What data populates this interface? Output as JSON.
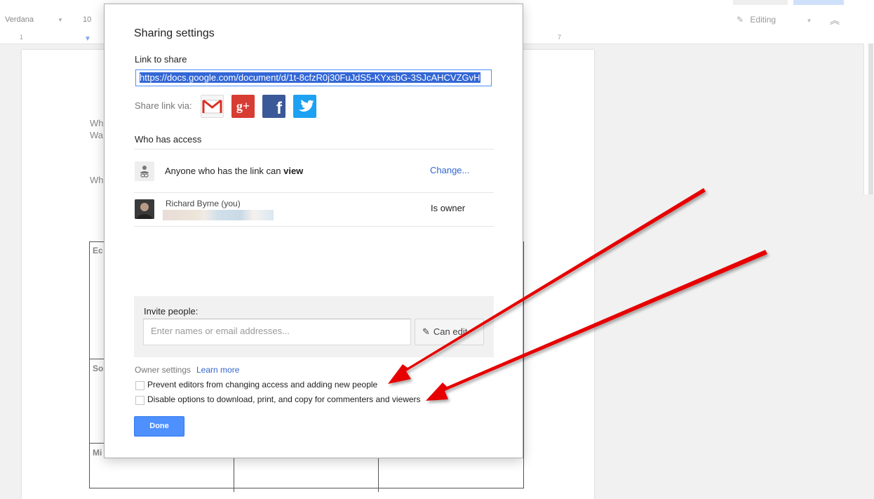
{
  "toolbar": {
    "font_name": "Verdana",
    "font_size": "10",
    "mode_label": "Editing"
  },
  "ruler": {
    "marks": [
      "1",
      "7"
    ]
  },
  "document": {
    "text_line_1": "Wh",
    "text_line_2": "Wa",
    "text_line_3": "Wh",
    "table_cells": [
      "Ec",
      "So",
      "Mi"
    ]
  },
  "dialog": {
    "title": "Sharing settings",
    "link_label": "Link to share",
    "link_url": "https://docs.google.com/document/d/1t-8cfzR0j30FuJdS5-KYxsbG-3SJcAHCVZGvH",
    "share_via_label": "Share link via:",
    "share_services": [
      "gmail-icon",
      "google-plus-icon",
      "facebook-icon",
      "twitter-icon"
    ],
    "who_has_access_label": "Who has access",
    "access_rows": [
      {
        "prefix": "Anyone who has the link can ",
        "emphasis": "view",
        "action": "Change..."
      },
      {
        "name": "Richard Byrne (you)",
        "role": "Is owner"
      }
    ],
    "invite_label": "Invite people:",
    "invite_placeholder": "Enter names or email addresses...",
    "can_edit_label": "Can edit",
    "owner_settings_label": "Owner settings",
    "learn_more_label": "Learn more",
    "checkboxes": [
      {
        "label": "Prevent editors from changing access and adding new people",
        "checked": false
      },
      {
        "label": "Disable options to download, print, and copy for commenters and viewers",
        "checked": false
      }
    ],
    "done_label": "Done"
  },
  "colors": {
    "accent_blue": "#4d90fe",
    "link_blue": "#3366cc",
    "annotation_red": "#e60000"
  }
}
